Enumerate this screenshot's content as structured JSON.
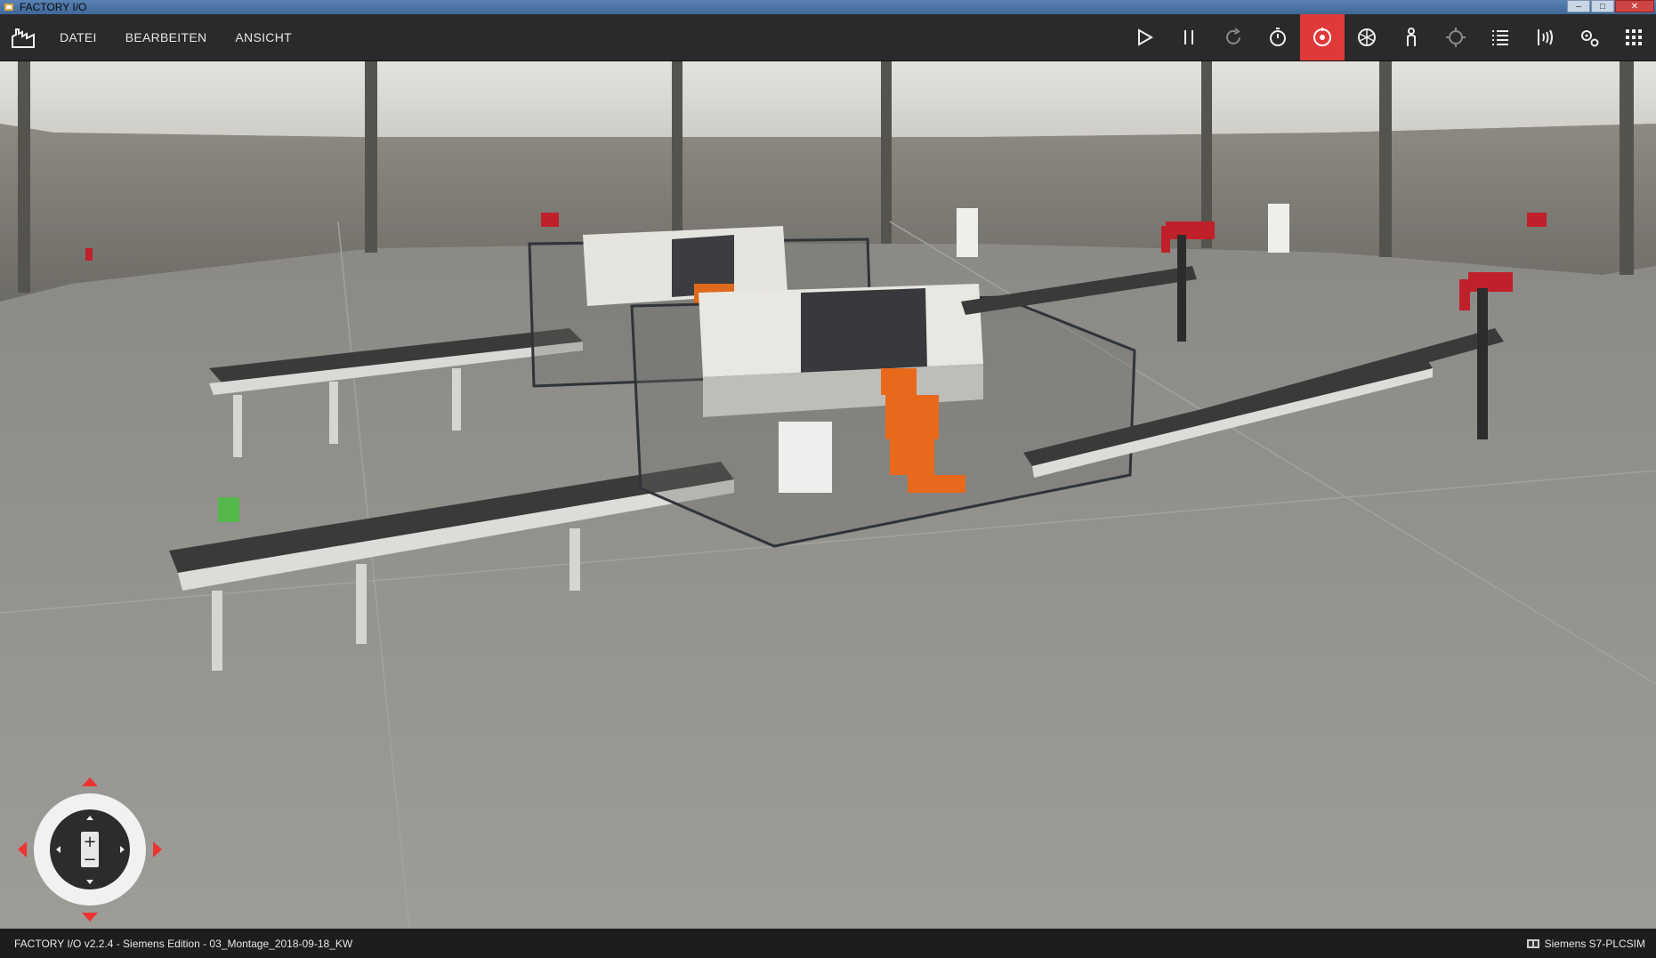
{
  "window": {
    "title": "FACTORY I/O",
    "controls": [
      "–",
      "□",
      "✕"
    ]
  },
  "menu": {
    "items": [
      "DATEI",
      "BEARBEITEN",
      "ANSICHT"
    ]
  },
  "toolbar": {
    "buttons": [
      {
        "name": "play-icon"
      },
      {
        "name": "pause-icon"
      },
      {
        "name": "reset-icon"
      },
      {
        "name": "timer-icon"
      },
      {
        "name": "camera-orbit-icon",
        "active": true
      },
      {
        "name": "camera-fly-icon"
      },
      {
        "name": "first-person-icon"
      },
      {
        "name": "target-icon"
      },
      {
        "name": "list-icon"
      },
      {
        "name": "sensor-icon"
      },
      {
        "name": "settings-icon"
      },
      {
        "name": "grid-icon"
      }
    ],
    "accent": "#e0393a"
  },
  "status": {
    "left": "FACTORY I/O v2.2.4 - Siemens Edition - 03_Montage_2018-09-18_KW",
    "right": "Siemens S7-PLCSIM"
  },
  "navigator": {
    "zoom_in": "+",
    "zoom_out": "−"
  }
}
